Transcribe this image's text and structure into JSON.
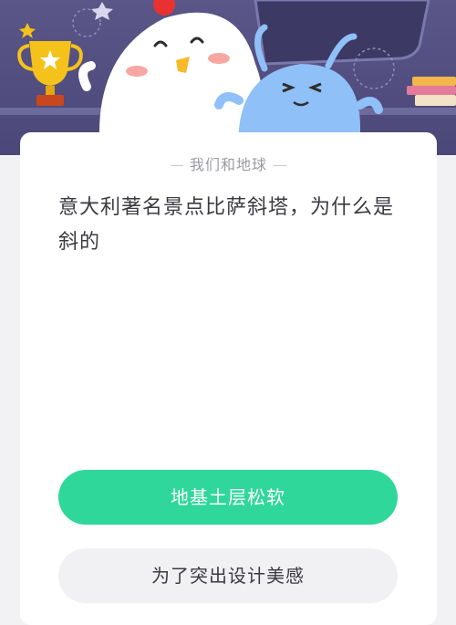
{
  "category": "我们和地球",
  "question": "意大利著名景点比萨斜塔，为什么是斜的",
  "options": [
    {
      "label": "地基土层松软",
      "state": "selected"
    },
    {
      "label": "为了突出设计美感",
      "state": "normal"
    }
  ],
  "colors": {
    "banner": "#4b4778",
    "accent_green": "#2fd89a",
    "option_gray": "#f1f1f4",
    "page_bg": "#f2f2f4"
  }
}
